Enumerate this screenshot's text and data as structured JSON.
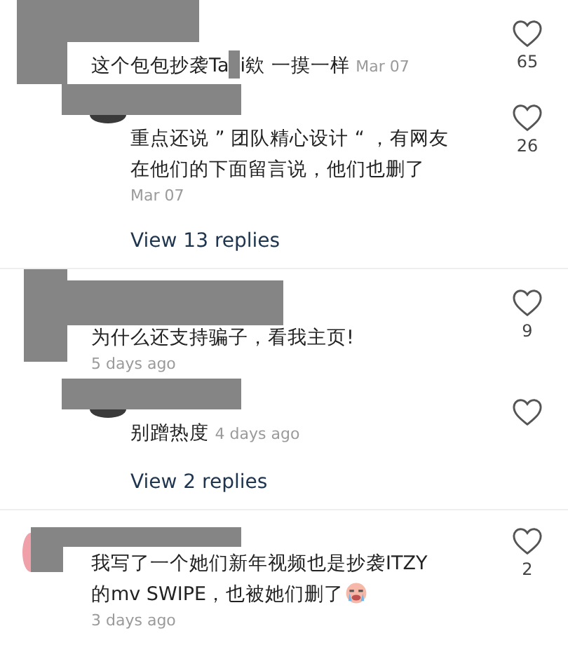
{
  "items": [
    {
      "kind": "comment",
      "text_parts": [
        "这个包包抄袭Ta",
        "i欸 一摸一样"
      ],
      "time": "Mar 07",
      "time_inline": true,
      "trailing_emoji": false,
      "likes": "65"
    },
    {
      "kind": "reply",
      "color": "#3a3a3a",
      "text_parts": [
        "重点还说 ” 团队精心设计 “ ，有网友在他们的下面留言说，他们也删了"
      ],
      "time": "Mar 07",
      "time_inline": false,
      "trailing_emoji": false,
      "likes": "26"
    },
    {
      "kind": "more",
      "label": "View 13 replies"
    },
    {
      "kind": "comment",
      "text_parts": [
        "为什么还支持骗子，看我主页!"
      ],
      "time": "5 days ago",
      "time_inline": false,
      "trailing_emoji": false,
      "likes": "9"
    },
    {
      "kind": "reply",
      "color": "#3a3a3a",
      "text_parts": [
        "别蹭热度"
      ],
      "time": "4 days ago",
      "time_inline": true,
      "trailing_emoji": false
    },
    {
      "kind": "more",
      "label": "View 2 replies"
    },
    {
      "kind": "comment",
      "color": "#f0a0a8",
      "text_parts": [
        "我写了一个她们新年视频也是抄袭ITZY的mv SWIPE，也被她们删了"
      ],
      "time": "3 days ago",
      "time_inline": false,
      "trailing_emoji": true,
      "likes": "2"
    }
  ]
}
